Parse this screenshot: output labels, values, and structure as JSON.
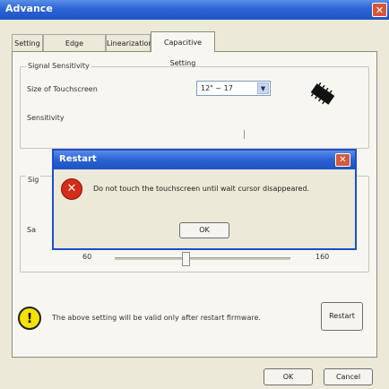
{
  "window": {
    "title": "Advance",
    "close_label": "✕"
  },
  "tabs": [
    {
      "label": "Setting",
      "active": false
    },
    {
      "label": "Edge Compensation",
      "active": false
    },
    {
      "label": "Linearization",
      "active": false
    },
    {
      "label": "Capacitive Setting",
      "active": true
    }
  ],
  "signal_group": {
    "title": "Signal Sensitivity",
    "size_label": "Size of Touchscreen",
    "size_value": "12\" ~ 17",
    "sensitivity_label": "Sensitivity",
    "second_group_title_partial": "Sig",
    "second_label_partial": "Sa"
  },
  "slider": {
    "min_label": "60",
    "max_label": "160"
  },
  "notice": {
    "text": "The above setting will be valid only after restart firmware."
  },
  "buttons": {
    "restart": "Restart",
    "ok": "OK",
    "cancel": "Cancel"
  },
  "dialog": {
    "title": "Restart",
    "close_label": "✕",
    "message": "Do not touch the touchscreen until wait cursor disappeared.",
    "ok": "OK",
    "icon_glyph": "✕"
  },
  "icons": {
    "warning": "!",
    "chip": "chip-icon"
  },
  "colors": {
    "titlebar": "#2b64d6",
    "error": "#d42c1a",
    "warning": "#f6e200"
  }
}
